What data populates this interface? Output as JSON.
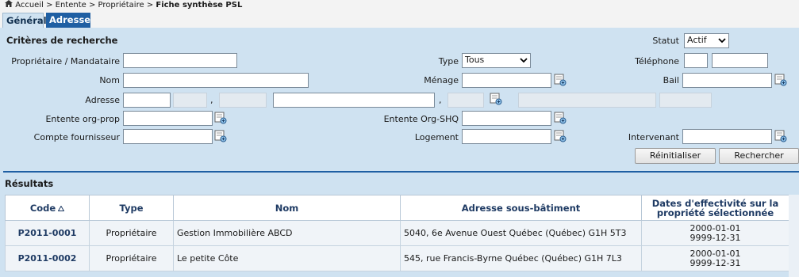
{
  "breadcrumb": {
    "home_icon": "home-icon",
    "path": "Accueil > Entente > Propriétaire > ",
    "current": "Fiche synthèse PSL"
  },
  "tabs": [
    {
      "label": "Général",
      "active": true
    },
    {
      "label": "Adresse",
      "active": false
    }
  ],
  "search": {
    "title": "Critères de recherche",
    "statut_label": "Statut",
    "statut_value": "Actif",
    "proprietaire_label": "Propriétaire / Mandataire",
    "proprietaire_value": "",
    "type_label": "Type",
    "type_value": "Tous",
    "telephone_label": "Téléphone",
    "nom_label": "Nom",
    "menage_label": "Ménage",
    "bail_label": "Bail",
    "adresse_label": "Adresse",
    "entente_org_prop_label": "Entente org-prop",
    "entente_org_shq_label": "Entente Org-SHQ",
    "compte_fournisseur_label": "Compte fournisseur",
    "logement_label": "Logement",
    "intervenant_label": "Intervenant",
    "comma": ","
  },
  "buttons": {
    "reset": "Réinitialiser",
    "search": "Rechercher"
  },
  "results": {
    "title": "Résultats",
    "columns": [
      "Code",
      "Type",
      "Nom",
      "Adresse sous-bâtiment",
      "Dates d'effectivité sur la propriété sélectionnée"
    ],
    "rows": [
      {
        "code": "P2011-0001",
        "type": "Propriétaire",
        "nom": "Gestion Immobilière ABCD",
        "adresse": "5040, 6e Avenue Ouest Québec (Québec) G1H 5T3",
        "date_debut": "2000-01-01",
        "date_fin": "9999-12-31"
      },
      {
        "code": "P2011-0002",
        "type": "Propriétaire",
        "nom": "Le petite Côte",
        "adresse": "545, rue Francis-Byrne Québec (Québec) G1H 7L3",
        "date_debut": "2000-01-01",
        "date_fin": "9999-12-31"
      }
    ]
  },
  "colors": {
    "panel_bg": "#cfe2f1",
    "tab_active_bg": "#1f5fa3",
    "separator": "#1f5fa3",
    "header_text": "#1e3a63"
  }
}
